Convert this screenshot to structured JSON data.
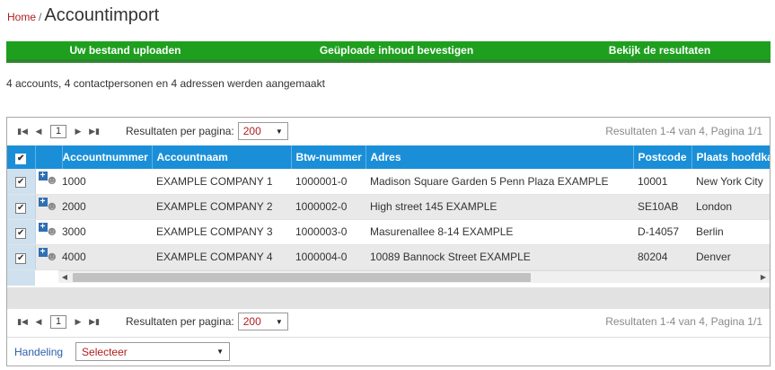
{
  "breadcrumb": {
    "home": "Home",
    "separator": "/",
    "title": "Accountimport"
  },
  "steps": [
    {
      "label": "Uw bestand uploaden"
    },
    {
      "label": "Geüploade inhoud bevestigen"
    },
    {
      "label": "Bekijk de resultaten"
    }
  ],
  "summary": "4 accounts, 4 contactpersonen en 4 adressen werden aangemaakt",
  "pager": {
    "page": "1",
    "per_page_label": "Resultaten per pagina:",
    "per_page_value": "200",
    "info": "Resultaten 1-4 van 4, Pagina 1/1"
  },
  "table": {
    "columns": [
      "Accountnummer",
      "Accountnaam",
      "Btw-nummer",
      "Adres",
      "Postcode",
      "Plaats hoofdkantoor"
    ],
    "rows": [
      {
        "accountnummer": "1000",
        "accountnaam": "EXAMPLE COMPANY 1",
        "btw": "1000001-0",
        "adres": "Madison Square Garden 5 Penn Plaza EXAMPLE",
        "postcode": "10001",
        "plaats": "New York City"
      },
      {
        "accountnummer": "2000",
        "accountnaam": "EXAMPLE COMPANY 2",
        "btw": "1000002-0",
        "adres": "High street 145 EXAMPLE",
        "postcode": "SE10AB",
        "plaats": "London"
      },
      {
        "accountnummer": "3000",
        "accountnaam": "EXAMPLE COMPANY 3",
        "btw": "1000003-0",
        "adres": "Masurenallee 8-14 EXAMPLE",
        "postcode": "D-14057",
        "plaats": "Berlin"
      },
      {
        "accountnummer": "4000",
        "accountnaam": "EXAMPLE COMPANY 4",
        "btw": "1000004-0",
        "adres": "10089 Bannock Street EXAMPLE",
        "postcode": "80204",
        "plaats": "Denver"
      }
    ]
  },
  "action": {
    "label": "Handeling",
    "select_value": "Selecteer"
  },
  "icons": {
    "first": "first-page-icon",
    "prev": "previous-page-icon",
    "next": "next-page-icon",
    "last": "last-page-icon",
    "add_contact": "add-contact-icon",
    "dropdown": "chevron-down-icon"
  },
  "colors": {
    "step_bar": "#1ea01e",
    "table_header": "#1a8fd8",
    "link_red": "#b01e1e",
    "label_blue": "#2a5fa8"
  }
}
